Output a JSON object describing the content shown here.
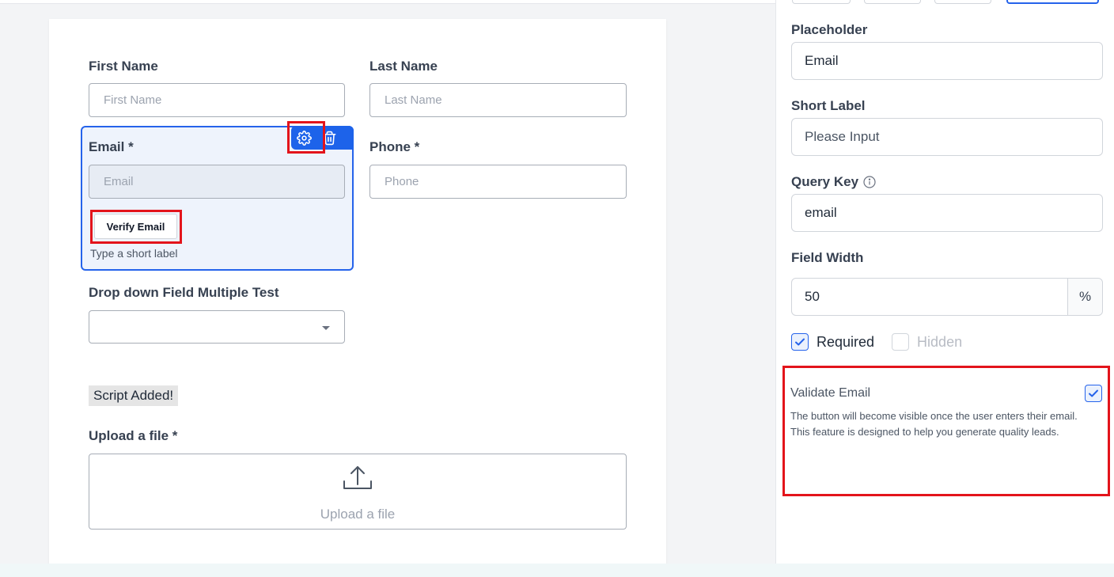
{
  "form": {
    "first_name": {
      "label": "First Name",
      "placeholder": "First Name"
    },
    "last_name": {
      "label": "Last Name",
      "placeholder": "Last Name"
    },
    "email": {
      "label": "Email *",
      "placeholder": "Email",
      "verify_button": "Verify Email",
      "short_label": "Type a short label",
      "toolbar_icons": [
        "gear-icon",
        "trash-icon"
      ]
    },
    "phone": {
      "label": "Phone *",
      "placeholder": "Phone"
    },
    "dropdown": {
      "label": "Drop down Field Multiple Test",
      "value": ""
    },
    "script_badge": "Script Added!",
    "upload": {
      "label": "Upload a file *",
      "button_text": "Upload a file"
    }
  },
  "settings": {
    "placeholder": {
      "label": "Placeholder",
      "value": "Email"
    },
    "short_label": {
      "label": "Short Label",
      "placeholder": "Please Input"
    },
    "query_key": {
      "label": "Query Key",
      "value": "email"
    },
    "field_width": {
      "label": "Field Width",
      "value": "50",
      "unit": "%"
    },
    "required": {
      "label": "Required",
      "checked": true
    },
    "hidden": {
      "label": "Hidden",
      "checked": false,
      "disabled": true
    },
    "validate_email": {
      "label": "Validate Email",
      "checked": true,
      "description": "The button will become visible once the user enters their email. This feature is designed to help you generate quality leads."
    }
  },
  "colors": {
    "accent": "#2563eb",
    "highlight": "#e3141b",
    "selected_bg": "#eef3fc"
  }
}
